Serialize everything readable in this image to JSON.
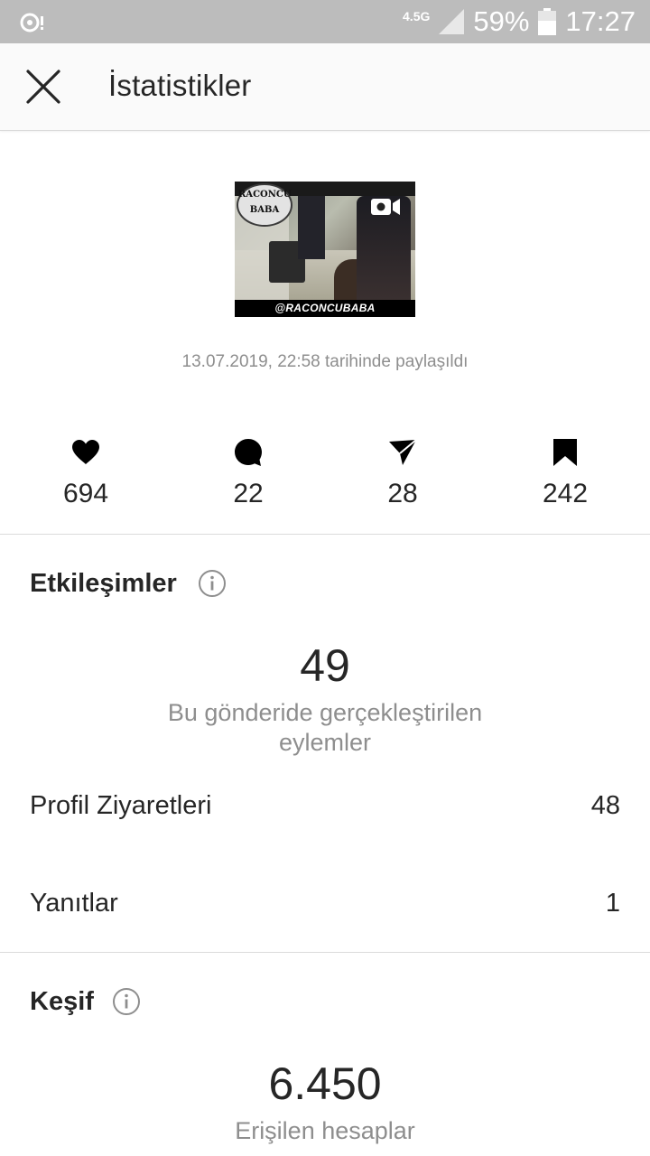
{
  "status_bar": {
    "network": "4.5G",
    "battery": "59%",
    "time": "17:27"
  },
  "header": {
    "title": "İstatistikler"
  },
  "post": {
    "thumbnail": {
      "logo_top": "RACONCU",
      "logo_bottom": "BABA",
      "caption": "@RACONCUBABA"
    },
    "shared_date": "13.07.2019, 22:58 tarihinde paylaşıldı"
  },
  "metrics": {
    "likes": "694",
    "comments": "22",
    "shares": "28",
    "saves": "242"
  },
  "interactions": {
    "title": "Etkileşimler",
    "total": "49",
    "description": "Bu gönderide gerçekleştirilen eylemler",
    "rows": [
      {
        "label": "Profil Ziyaretleri",
        "value": "48"
      },
      {
        "label": "Yanıtlar",
        "value": "1"
      }
    ]
  },
  "discovery": {
    "title": "Keşif",
    "total": "6.450",
    "description": "Erişilen hesaplar"
  },
  "icons": {
    "close": "close-icon",
    "heart": "heart-icon",
    "comment": "comment-icon",
    "share": "send-icon",
    "save": "bookmark-icon",
    "info": "info-icon",
    "video": "video-camera-icon"
  },
  "colors": {
    "status_bar": "#bcbcbc",
    "text_primary": "#262626",
    "text_secondary": "#8e8e8e",
    "divider": "#dbdbdb"
  }
}
